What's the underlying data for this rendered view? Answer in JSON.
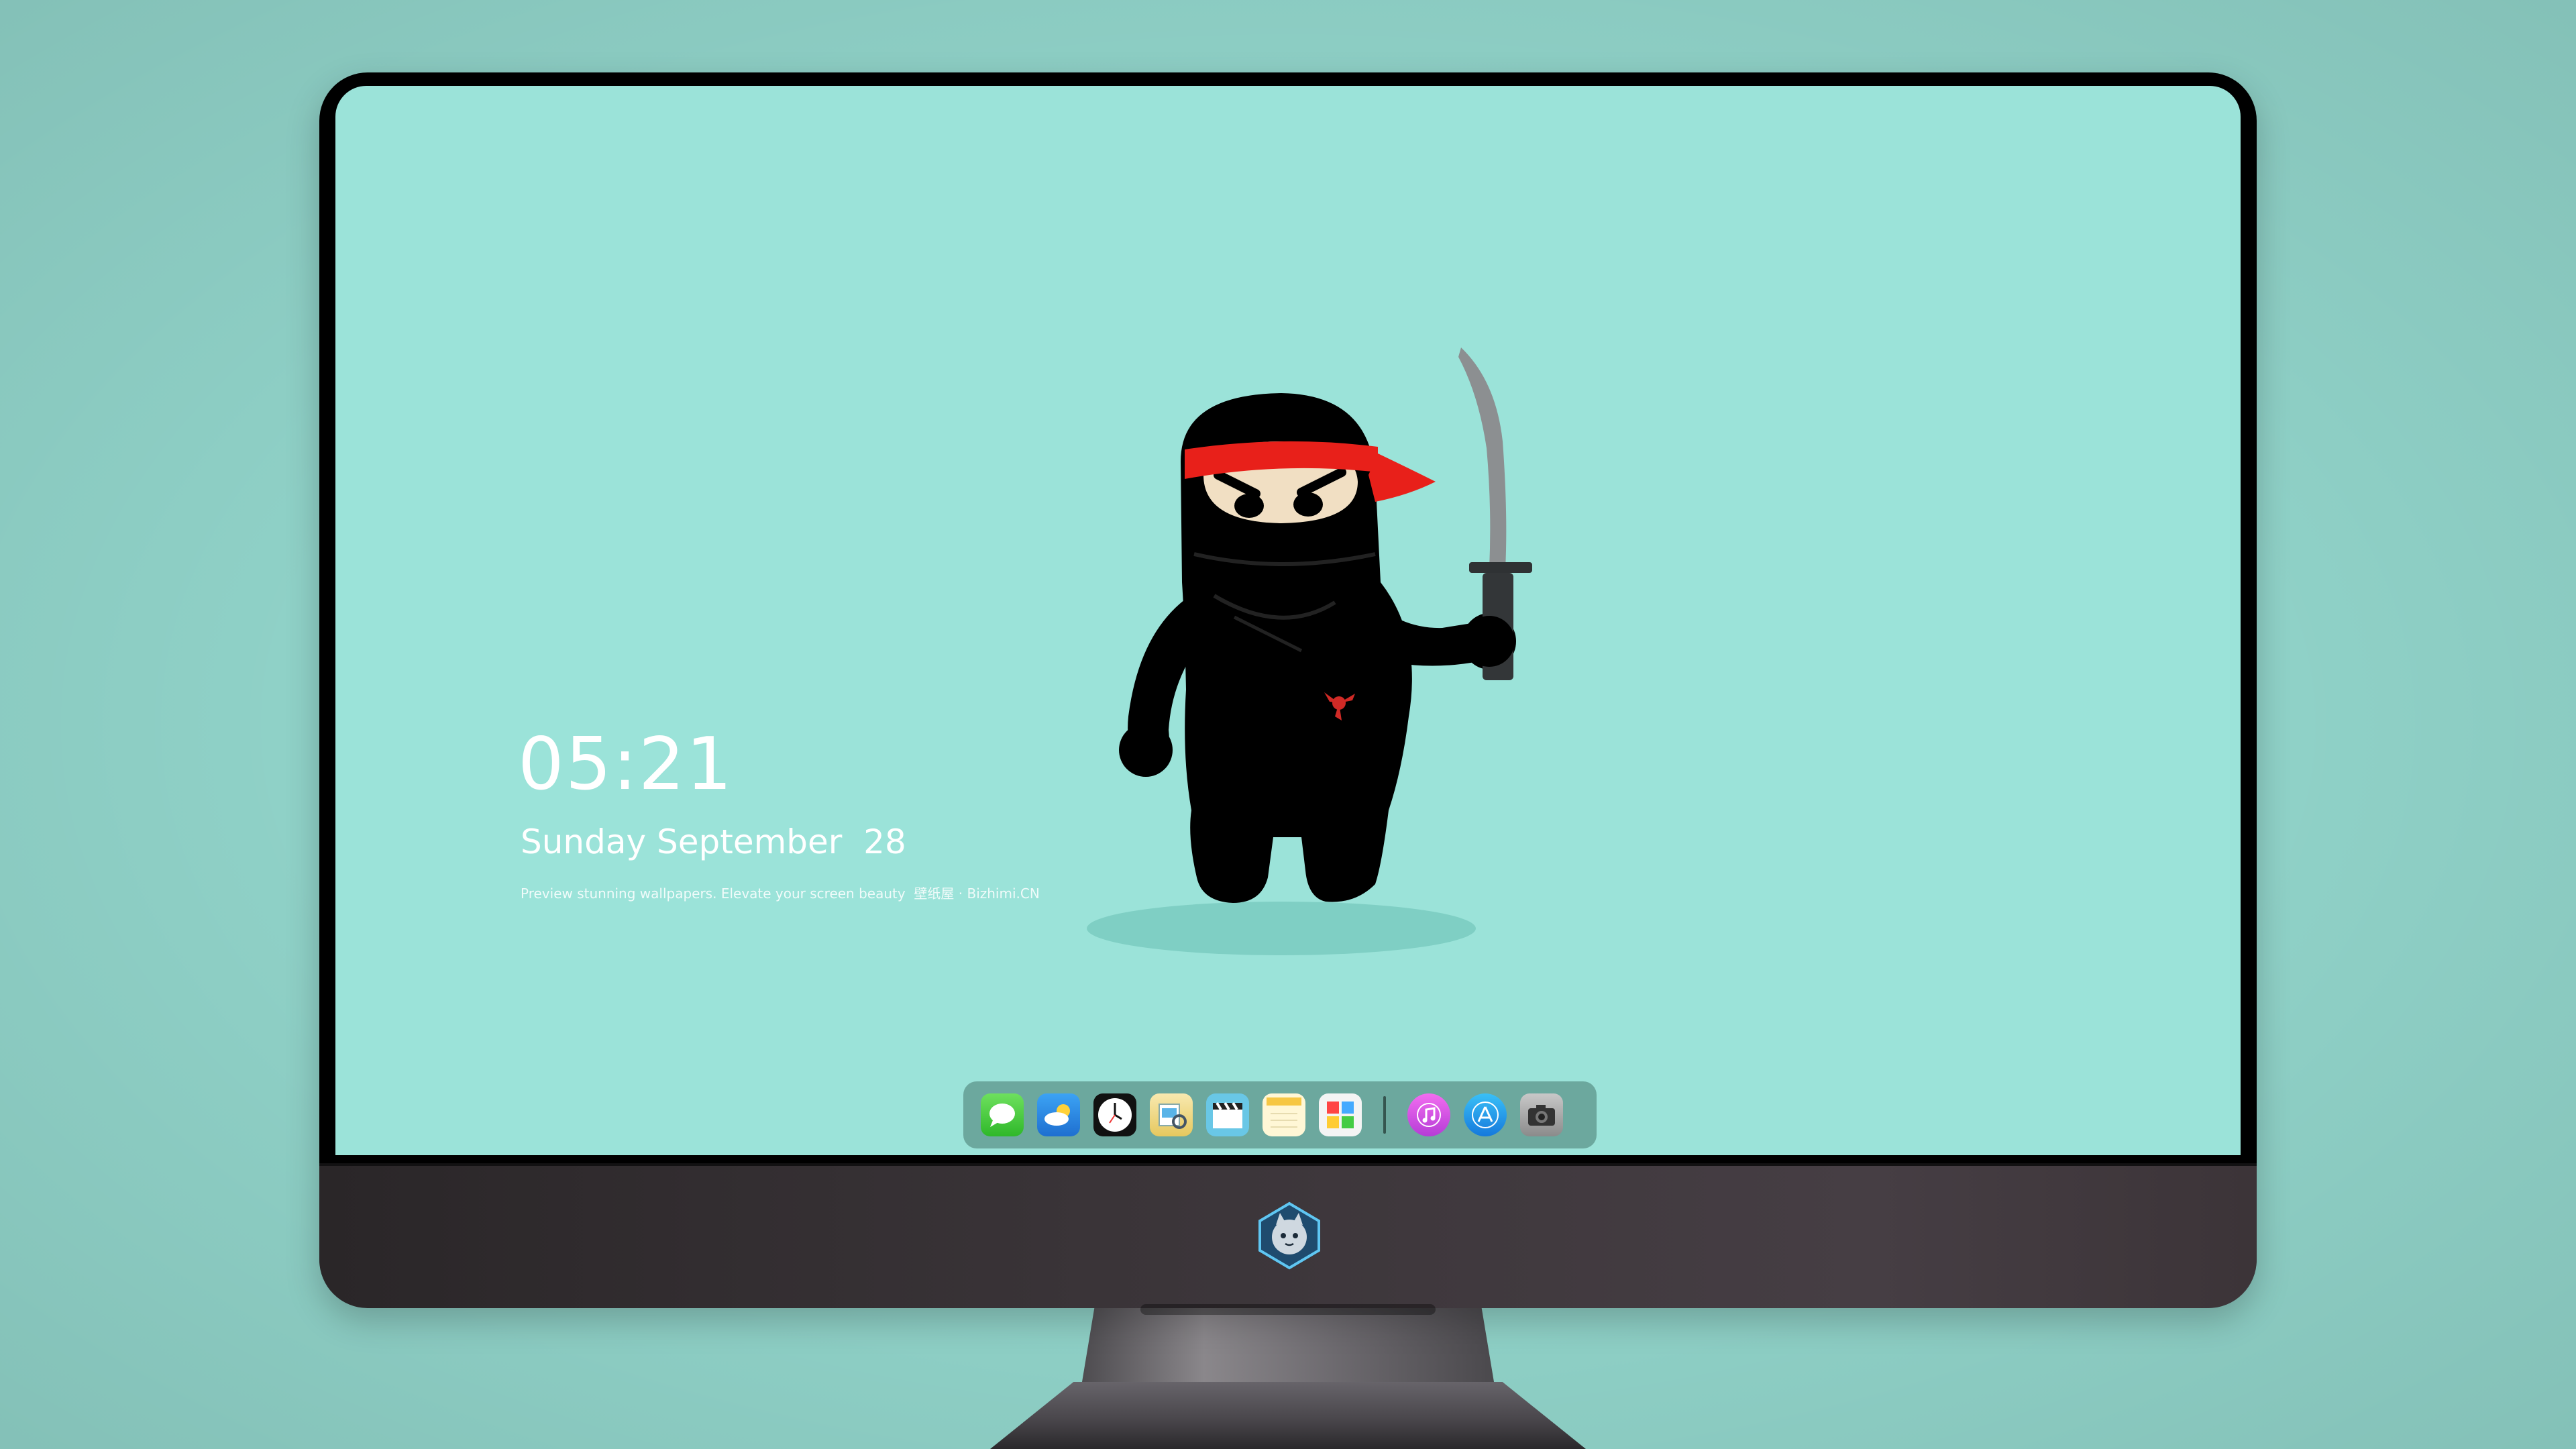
{
  "lockscreen": {
    "time": "05:21",
    "date": "Sunday September  28",
    "tagline": "Preview stunning wallpapers. Elevate your screen beauty  壁纸屋 · Bizhimi.CN"
  },
  "dock": {
    "apps": [
      {
        "name": "Messages",
        "icon": "messages-icon"
      },
      {
        "name": "Weather",
        "icon": "weather-icon"
      },
      {
        "name": "Clock",
        "icon": "clock-icon"
      },
      {
        "name": "Preview",
        "icon": "preview-icon"
      },
      {
        "name": "Clips",
        "icon": "clapperboard-icon"
      },
      {
        "name": "Notes",
        "icon": "notes-icon"
      },
      {
        "name": "Photos",
        "icon": "photo-gallery-icon"
      },
      {
        "name": "iTunes",
        "icon": "music-icon"
      },
      {
        "name": "App Store",
        "icon": "app-store-icon"
      },
      {
        "name": "Camera",
        "icon": "camera-icon"
      }
    ]
  },
  "colors": {
    "background": "#8fd1c7",
    "screen": "#9be3d9",
    "headband": "#e8201a",
    "ninja": "#000000"
  }
}
